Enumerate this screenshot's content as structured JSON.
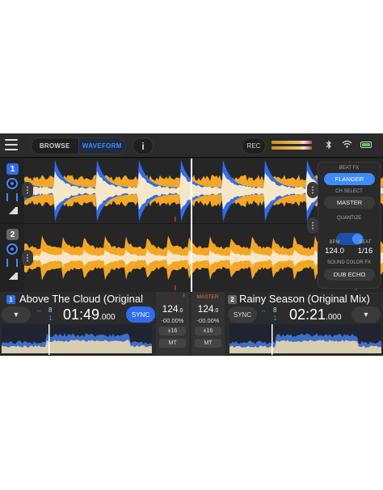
{
  "topbar": {
    "browse": "BROWSE",
    "waveform": "WAVEFORM",
    "info": "i",
    "rec": "REC",
    "icons": [
      "menu-icon",
      "bluetooth-icon",
      "wifi-icon",
      "battery-icon"
    ]
  },
  "decks": {
    "deck1": {
      "num": "1",
      "title": "Above The Cloud (Original",
      "time_main": "01:49",
      "time_ms": ".000",
      "loop": "8",
      "loop_sub": "1",
      "sync": "SYNC",
      "dropdown": "▼"
    },
    "deck2": {
      "num": "2",
      "title": "Rainy Season (Original Mix)",
      "time_main": "02:21",
      "time_ms": ".000",
      "loop": "8",
      "loop_sub": "1",
      "sync": "SYNC",
      "dropdown": "▼"
    }
  },
  "center": {
    "master": "MASTER",
    "master_num": "I",
    "left": {
      "bpm": "124",
      "bpm_dec": ".0",
      "pct": "-00.00%",
      "range": "±16",
      "mt": "MT"
    },
    "right": {
      "bpm": "124",
      "bpm_dec": ".0",
      "pct": "-00.00%",
      "range": "±16",
      "mt": "MT"
    }
  },
  "fx": {
    "beat_fx_label": "BEAT FX",
    "beat_fx_value": "FLANGER",
    "ch_select_label": "CH SELECT",
    "ch_select_value": "MASTER",
    "quantize_label": "QUANTIZE",
    "quantize_on": true,
    "bpm_label": "BPM",
    "bpm_value": "124.0",
    "beat_label": "BEAT",
    "beat_value": "1/16",
    "scfx_label": "SOUND COLOR FX",
    "scfx_value": "DUB ECHO"
  },
  "colors": {
    "accent": "#3d8bff",
    "wave_orange": "#f5a623",
    "wave_blue": "#2f6cf0",
    "wave_cream": "#f6e7c8",
    "master": "#e46a3a"
  }
}
